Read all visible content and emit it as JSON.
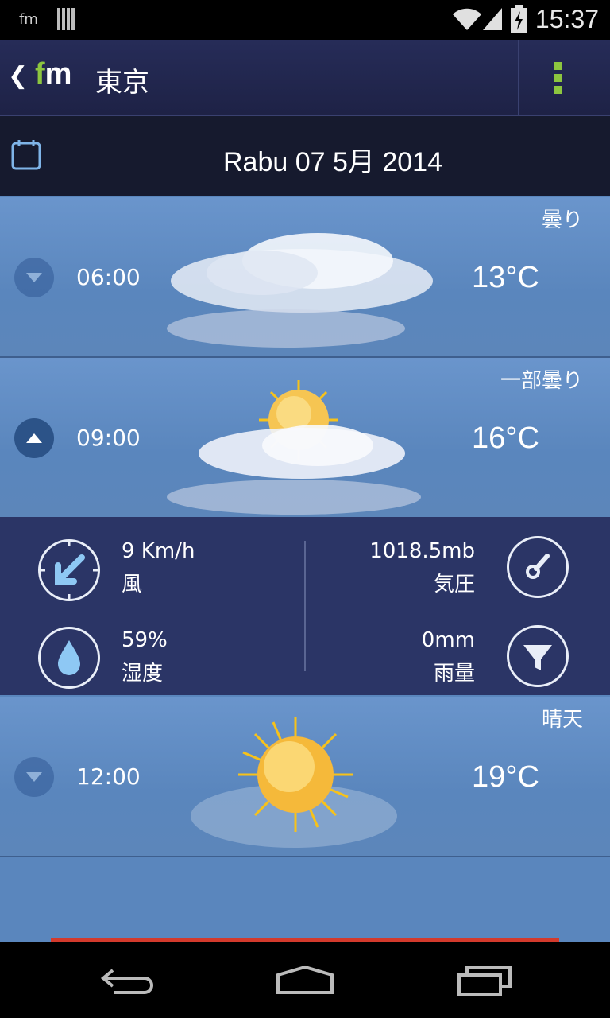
{
  "status_bar": {
    "app_label": "fm",
    "time": "15:37"
  },
  "action_bar": {
    "back_glyph": "❮",
    "logo_f": "f",
    "logo_m": "m",
    "city": "東京"
  },
  "date_bar": {
    "date": "Rabu 07 5月 2014"
  },
  "forecast": [
    {
      "time": "06:00",
      "temp": "13°C",
      "condition": "曇り",
      "icon": "cloud-icon",
      "expanded": false
    },
    {
      "time": "09:00",
      "temp": "16°C",
      "condition": "一部曇り",
      "icon": "partly-cloudy-icon",
      "expanded": true
    },
    {
      "time": "12:00",
      "temp": "19°C",
      "condition": "晴天",
      "icon": "sun-icon",
      "expanded": false
    }
  ],
  "details": {
    "wind": {
      "value": "9 Km/h",
      "label": "風",
      "icon": "wind-direction-icon"
    },
    "humidity": {
      "value": "59%",
      "label": "湿度",
      "icon": "water-drop-icon"
    },
    "pressure": {
      "value": "1018.5mb",
      "label": "気圧",
      "icon": "gauge-icon"
    },
    "rain": {
      "value": "0mm",
      "label": "雨量",
      "icon": "funnel-icon"
    }
  },
  "colors": {
    "accent_green": "#8dc63f",
    "action_bar": "#262c58",
    "sky": "#5a86bd",
    "details_panel": "#2b3566",
    "progress_red": "#d33a2c"
  }
}
